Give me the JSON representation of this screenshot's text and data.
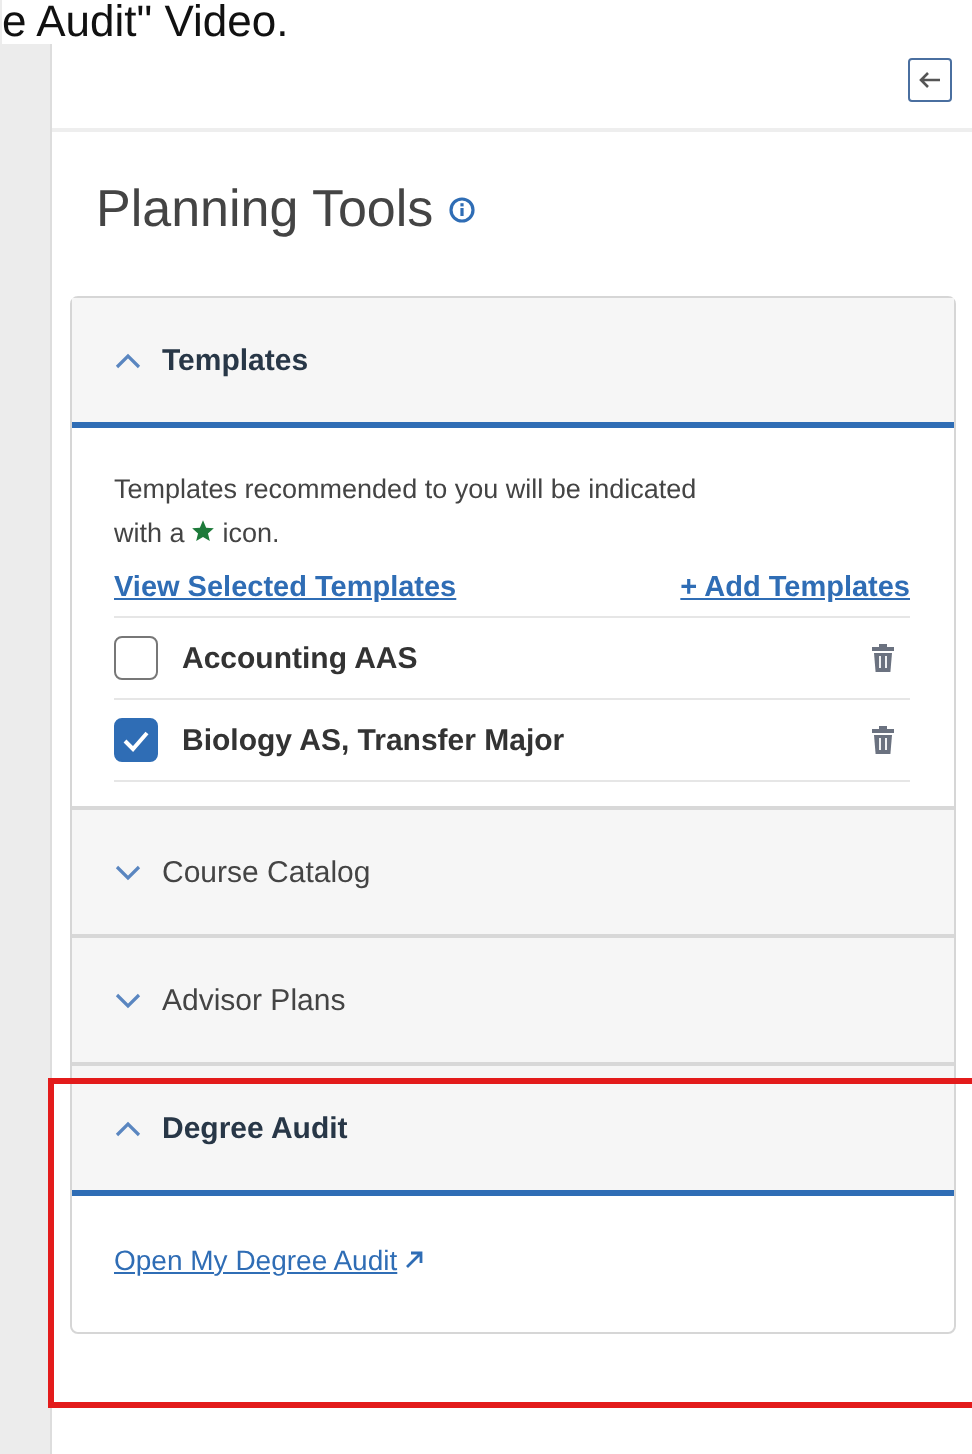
{
  "caption": "e Audit\" Video.",
  "title": "Planning Tools",
  "sections": [
    {
      "title": "Templates",
      "expanded": true,
      "highlighted": false,
      "kind": "templates",
      "note_start": "Templates recommended to you will be indicated",
      "note_mid": "with a",
      "note_end": "icon.",
      "links": [
        "View Selected Templates",
        "+ Add Templates"
      ],
      "items": [
        {
          "label": "Accounting AAS",
          "checked": false
        },
        {
          "label": "Biology AS, Transfer Major",
          "checked": true
        }
      ]
    },
    {
      "title": "Course Catalog",
      "expanded": false,
      "highlighted": false
    },
    {
      "title": "Advisor Plans",
      "expanded": false,
      "highlighted": false
    },
    {
      "title": "Degree Audit",
      "expanded": true,
      "highlighted": true,
      "kind": "links",
      "links": [
        "Open My Degree Audit"
      ]
    }
  ]
}
